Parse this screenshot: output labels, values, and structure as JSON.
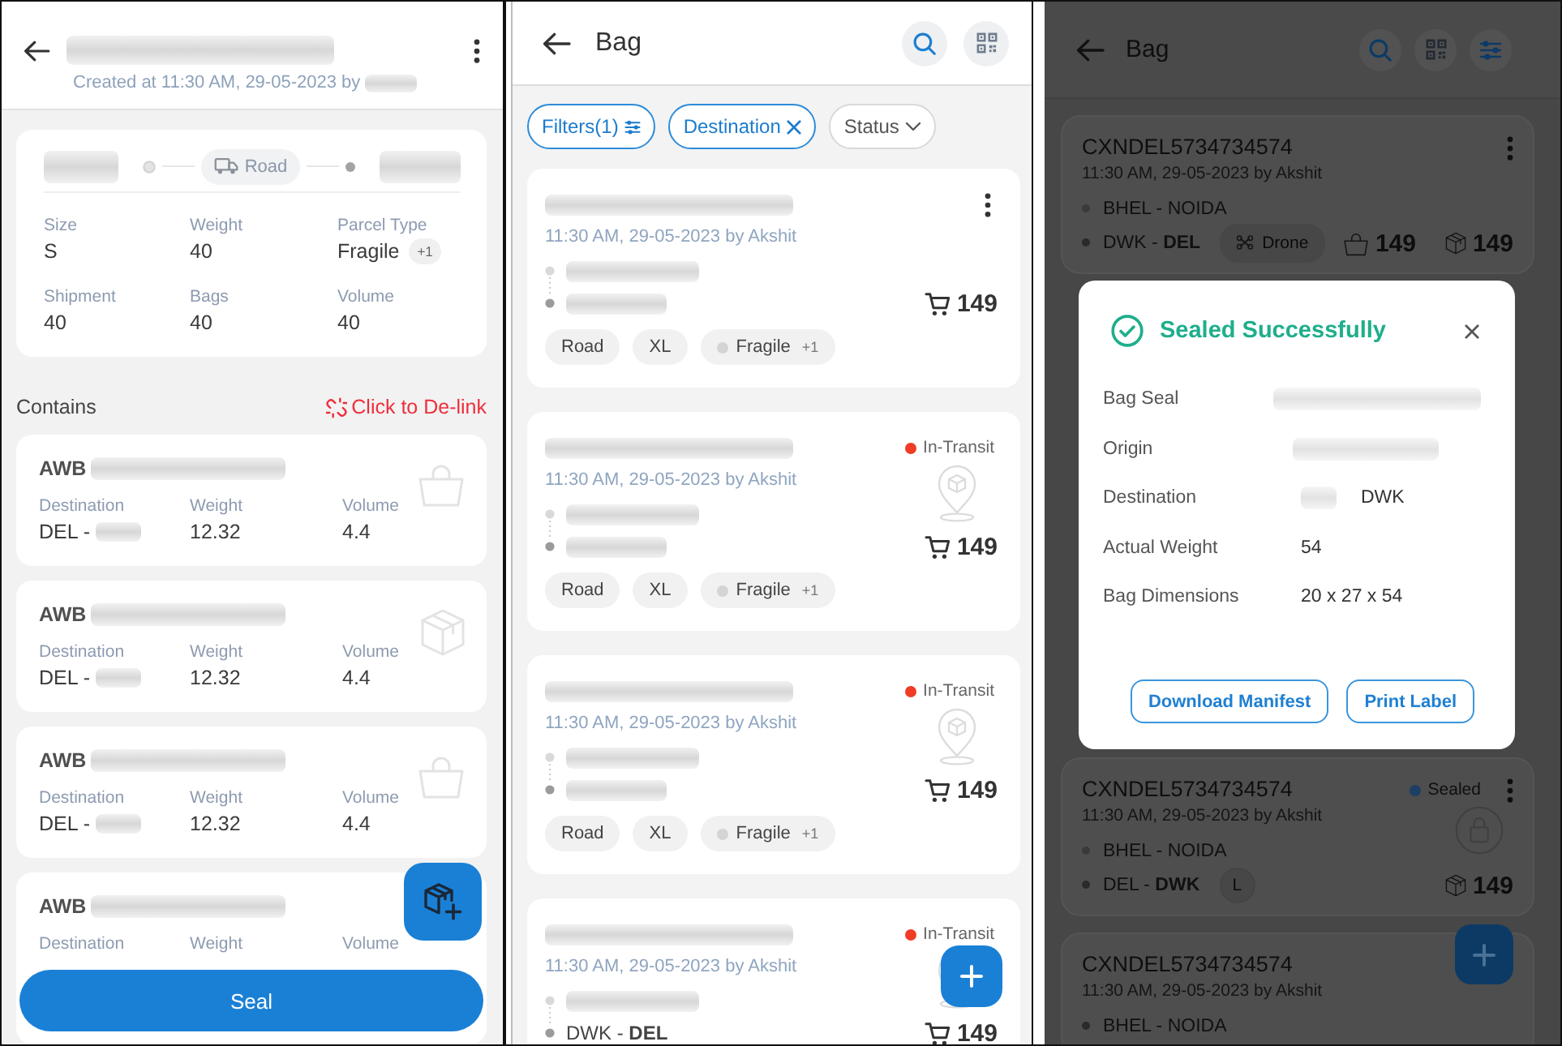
{
  "screens": [
    {
      "kind": "bag_detail",
      "header": {
        "title": {
          "redacted": true
        },
        "subtitle": {
          "text": "Created at 11:30 AM, 29-05-2023 by",
          "redacted_tail": true
        }
      },
      "summary": {
        "origin": {
          "redacted": true
        },
        "mode": "Road",
        "destination": {
          "redacted": true
        },
        "fields": [
          {
            "label": "Size",
            "value": "S"
          },
          {
            "label": "Weight",
            "value": "40"
          },
          {
            "label": "Parcel Type",
            "value": "Fragile",
            "extra": "+1"
          },
          {
            "label": "Shipment",
            "value": "40"
          },
          {
            "label": "Bags",
            "value": "40"
          },
          {
            "label": "Volume",
            "value": "40"
          }
        ]
      },
      "contains": {
        "title": "Contains",
        "action": "Click to De-link"
      },
      "items": [
        {
          "kind": "bag",
          "number": {
            "text": "AWB",
            "redacted_tail": true
          },
          "fields": [
            {
              "label": "Destination",
              "value": "DEL -",
              "redacted_tail": true
            },
            {
              "label": "Weight",
              "value": "12.32"
            },
            {
              "label": "Volume",
              "value": "4.4"
            }
          ]
        },
        {
          "kind": "shipment",
          "number": {
            "text": "AWB",
            "redacted_tail": true
          },
          "fields": [
            {
              "label": "Destination",
              "value": "DEL -",
              "redacted_tail": true
            },
            {
              "label": "Weight",
              "value": "12.32"
            },
            {
              "label": "Volume",
              "value": "4.4"
            }
          ]
        },
        {
          "kind": "bag",
          "number": {
            "text": "AWB",
            "redacted_tail": true
          },
          "fields": [
            {
              "label": "Destination",
              "value": "DEL -",
              "redacted_tail": true
            },
            {
              "label": "Weight",
              "value": "12.32"
            },
            {
              "label": "Volume",
              "value": "4.4"
            }
          ]
        },
        {
          "number": {
            "text": "AWB",
            "redacted_tail": true
          },
          "fields": [
            {
              "label": "Destination"
            },
            {
              "label": "Weight"
            },
            {
              "label": "Volume"
            }
          ]
        }
      ],
      "fab": {
        "kind": "add_shipment"
      },
      "seal_button": "Seal"
    },
    {
      "kind": "bag_list",
      "title": "Bag",
      "actions": [
        {
          "kind": "search"
        },
        {
          "kind": "scan"
        }
      ],
      "filters": [
        {
          "kind": "filters",
          "label": "Filters(1)",
          "selected": true
        },
        {
          "kind": "removable",
          "label": "Destination",
          "selected": true
        },
        {
          "kind": "dropdown",
          "label": "Status",
          "selected": false
        }
      ],
      "cards": [
        {
          "title": {
            "redacted": true
          },
          "menu": true,
          "date": "11:30 AM, 29-05-2023 by Akshit",
          "routes": [
            {
              "redacted": true
            },
            {
              "redacted": true
            }
          ],
          "counts": [
            {
              "kind": "items",
              "value": "149"
            }
          ],
          "tags": [
            {
              "kind": "plain",
              "label": "Road"
            },
            {
              "kind": "plain",
              "label": "XL"
            },
            {
              "kind": "parcel_type",
              "label": "Fragile",
              "extra": "+1"
            }
          ]
        },
        {
          "title": {
            "redacted": true
          },
          "menu": false,
          "status": {
            "kind": "in_transit",
            "label": "In-Transit",
            "color": "#f03c24"
          },
          "date": "11:30 AM, 29-05-2023 by Akshit",
          "routes": [
            {
              "redacted": true
            },
            {
              "redacted": true
            }
          ],
          "counts": [
            {
              "kind": "items",
              "value": "149"
            }
          ],
          "tags": [
            {
              "kind": "plain",
              "label": "Road"
            },
            {
              "kind": "plain",
              "label": "XL"
            },
            {
              "kind": "parcel_type",
              "label": "Fragile",
              "extra": "+1"
            }
          ]
        },
        {
          "title": {
            "redacted": true
          },
          "menu": false,
          "status": {
            "kind": "in_transit",
            "label": "In-Transit",
            "color": "#f03c24"
          },
          "date": "11:30 AM, 29-05-2023 by Akshit",
          "routes": [
            {
              "redacted": true
            },
            {
              "redacted": true
            }
          ],
          "counts": [
            {
              "kind": "items",
              "value": "149"
            }
          ],
          "tags": [
            {
              "kind": "plain",
              "label": "Road"
            },
            {
              "kind": "plain",
              "label": "XL"
            },
            {
              "kind": "parcel_type",
              "label": "Fragile",
              "extra": "+1"
            }
          ]
        },
        {
          "title": {
            "redacted": true
          },
          "menu": false,
          "status": {
            "kind": "in_transit",
            "label": "In-Transit",
            "color": "#f03c24"
          },
          "date": "11:30 AM, 29-05-2023 by Akshit",
          "routes": [
            {
              "redacted": true
            },
            {
              "text": "DWK - **DEL**"
            }
          ],
          "counts": [
            {
              "kind": "items",
              "value": "149"
            }
          ]
        }
      ],
      "fab": {
        "kind": "add"
      }
    },
    {
      "kind": "sealed_bag_list",
      "title": "Bag",
      "actions": [
        {
          "kind": "search"
        },
        {
          "kind": "scan"
        },
        {
          "kind": "filter"
        }
      ],
      "cards": [
        {
          "title": {
            "text": "CXNDEL5734734574"
          },
          "menu": true,
          "date": "11:30 AM, 29-05-2023 by Akshit",
          "routes": [
            {
              "text": "BHEL - NOIDA"
            },
            {
              "text": "DWK - **DEL**"
            }
          ],
          "tags": [
            {
              "kind": "drone",
              "label": "Drone"
            }
          ],
          "counts": [
            {
              "kind": "bags",
              "value": "149"
            },
            {
              "kind": "shipments",
              "value": "149"
            }
          ]
        },
        {
          "title": {
            "text": "CXNDEL5734734574"
          },
          "menu": true,
          "status": {
            "kind": "sealed",
            "label": "Sealed",
            "color": "#1d3f66"
          },
          "date": "11:30 AM, 29-05-2023 by Akshit",
          "routes": [
            {
              "text": "BHEL - NOIDA"
            },
            {
              "text": "DEL - **DWK**"
            }
          ],
          "tags": [
            {
              "kind": "size",
              "label": "L"
            }
          ],
          "counts": [
            {
              "kind": "shipments",
              "value": "149"
            }
          ]
        },
        {
          "title": {
            "text": "CXNDEL5734734574"
          },
          "menu": false,
          "date": "11:30 AM, 29-05-2023 by Akshit",
          "routes": [
            {
              "text": "BHEL - NOIDA"
            }
          ]
        }
      ],
      "modal": {
        "title": "Sealed Successfully",
        "rows": [
          {
            "label": "Bag Seal",
            "redacted": true
          },
          {
            "label": "Origin",
            "redacted": true
          },
          {
            "label": "Destination",
            "value": "DWK",
            "redacted_head": true
          },
          {
            "label": "Actual Weight",
            "value": "54"
          },
          {
            "label": "Bag Dimensions",
            "value": "20 x 27 x 54"
          }
        ],
        "buttons": [
          "Download Manifest",
          "Print Label"
        ]
      },
      "fab": {
        "kind": "add"
      }
    }
  ]
}
